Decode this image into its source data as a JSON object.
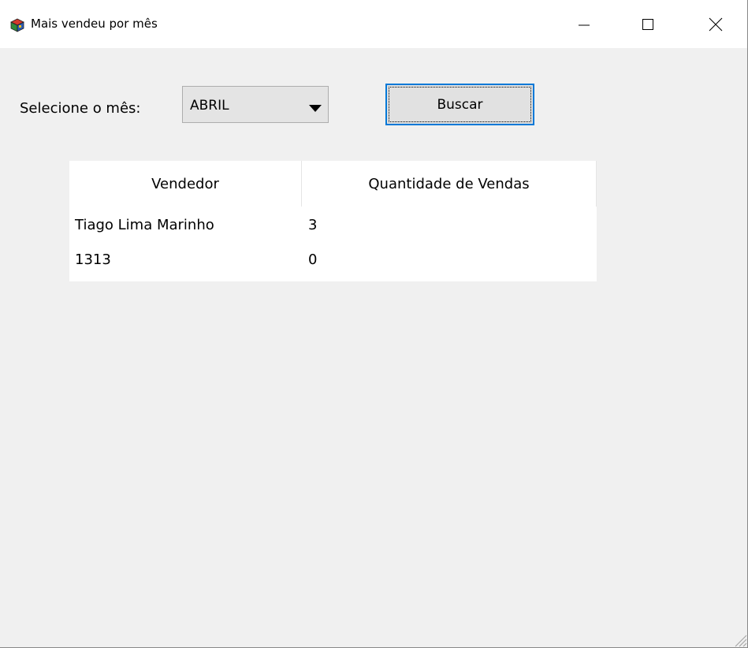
{
  "window": {
    "title": "Mais vendeu por mês",
    "icon": "app-cube-icon"
  },
  "title_buttons": {
    "minimize_icon": "minimize-icon",
    "maximize_icon": "maximize-icon",
    "close_icon": "close-icon"
  },
  "form": {
    "month_label": "Selecione o mês:",
    "month_selected": "ABRIL",
    "search_label": "Buscar"
  },
  "table": {
    "columns": [
      "Vendedor",
      "Quantidade de Vendas"
    ],
    "rows": [
      [
        "Tiago Lima Marinho",
        "3"
      ],
      [
        "1313",
        "0"
      ]
    ]
  },
  "colors": {
    "window_bg": "#f0f0f0",
    "titlebar_bg": "#ffffff",
    "focus_border": "#0078d7"
  }
}
